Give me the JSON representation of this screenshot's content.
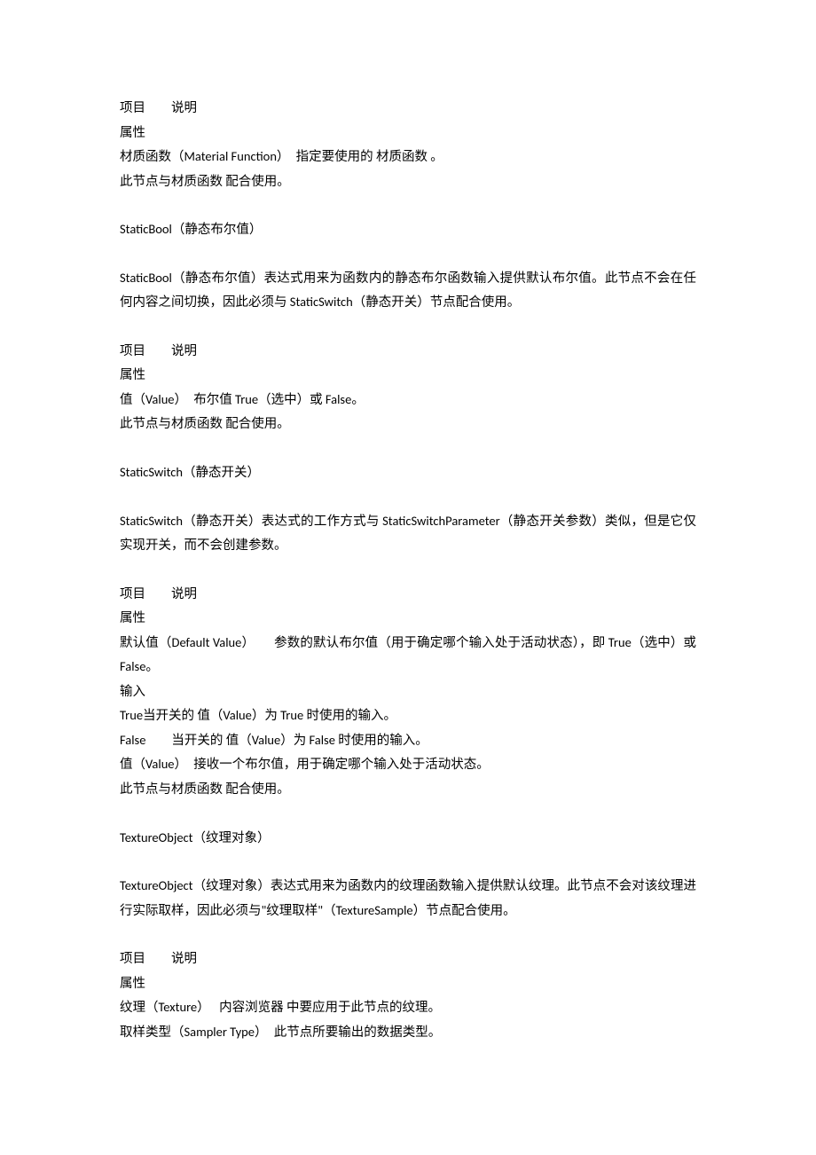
{
  "sections": [
    {
      "lines": [
        "项目　　说明",
        "属性",
        "材质函数（Material Function）　指定要使用的 材质函数 。",
        "此节点与材质函数 配合使用。"
      ]
    },
    {
      "lines": [
        "StaticBool（静态布尔值）"
      ]
    },
    {
      "lines": [
        "StaticBool（静态布尔值）表达式用来为函数内的静态布尔函数输入提供默认布尔值。此节点不会在任何内容之间切换，因此必须与 StaticSwitch（静态开关）节点配合使用。"
      ]
    },
    {
      "lines": [
        "项目　　说明",
        "属性",
        "值（Value）　布尔值 True（选中）或 False。",
        "此节点与材质函数 配合使用。"
      ]
    },
    {
      "lines": [
        "StaticSwitch（静态开关）"
      ]
    },
    {
      "lines": [
        "StaticSwitch（静态开关）表达式的工作方式与 StaticSwitchParameter（静态开关参数）类似，但是它仅实现开关，而不会创建参数。"
      ]
    },
    {
      "lines": [
        "项目　　说明",
        "属性",
        "默认值（Default Value）　　参数的默认布尔值（用于确定哪个输入处于活动状态），即 True（选中）或 False。",
        "输入",
        "True当开关的 值（Value）为 True 时使用的输入。",
        "False　　当开关的 值（Value）为 False 时使用的输入。",
        "值（Value）　接收一个布尔值，用于确定哪个输入处于活动状态。",
        "此节点与材质函数 配合使用。"
      ]
    },
    {
      "lines": [
        "TextureObject（纹理对象）"
      ]
    },
    {
      "lines": [
        "TextureObject（纹理对象）表达式用来为函数内的纹理函数输入提供默认纹理。此节点不会对该纹理进行实际取样，因此必须与\"纹理取样\"（TextureSample）节点配合使用。"
      ]
    },
    {
      "lines": [
        "项目　　说明",
        "属性",
        "纹理（Texture）　 内容浏览器 中要应用于此节点的纹理。",
        "取样类型（Sampler Type）　此节点所要输出的数据类型。"
      ]
    }
  ]
}
